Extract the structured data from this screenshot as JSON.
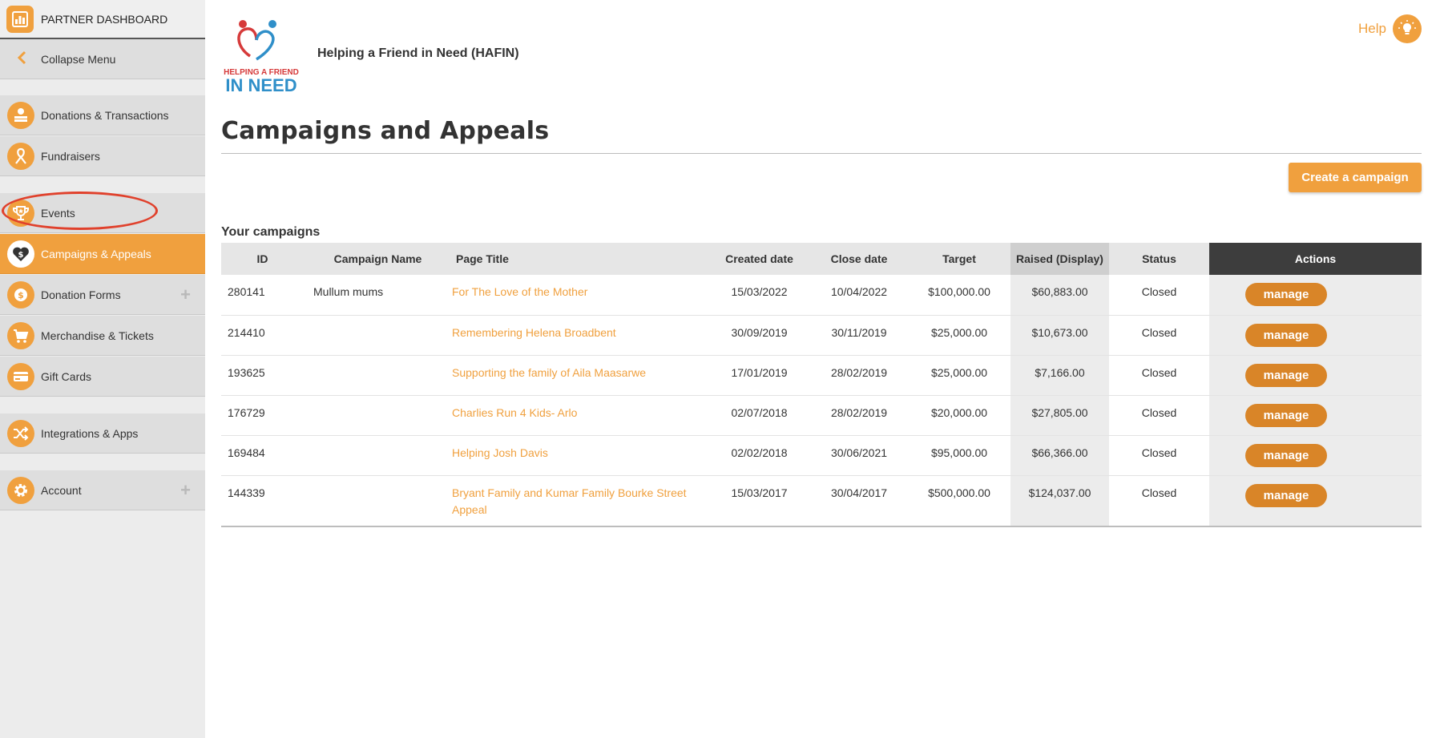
{
  "sidebar": {
    "header_label": "PARTNER DASHBOARD",
    "collapse_label": "Collapse Menu",
    "items": [
      {
        "label": "Donations & Transactions",
        "icon": "donations-icon"
      },
      {
        "label": "Fundraisers",
        "icon": "ribbon-icon"
      },
      {
        "label": "Events",
        "icon": "trophy-icon"
      },
      {
        "label": "Campaigns & Appeals",
        "icon": "heart-dollar-icon",
        "active": true
      },
      {
        "label": "Donation Forms",
        "icon": "coin-icon",
        "expandable": true
      },
      {
        "label": "Merchandise & Tickets",
        "icon": "cart-icon"
      },
      {
        "label": "Gift Cards",
        "icon": "gift-card-icon"
      },
      {
        "label": "Integrations & Apps",
        "icon": "shuffle-icon"
      },
      {
        "label": "Account",
        "icon": "gear-icon",
        "expandable": true
      }
    ],
    "plus_symbol": "+"
  },
  "header": {
    "logo_text_line1": "HELPING A FRIEND",
    "logo_text_line2": "IN NEED",
    "org_name": "Helping a Friend in Need (HAFIN)",
    "help_label": "Help"
  },
  "main": {
    "page_title": "Campaigns and Appeals",
    "create_button_label": "Create a campaign",
    "section_label": "Your campaigns",
    "columns": [
      "ID",
      "Campaign Name",
      "Page Title",
      "Created date",
      "Close date",
      "Target",
      "Raised (Display)",
      "Status",
      "Actions"
    ],
    "rows": [
      {
        "id": "280141",
        "name": "Mullum mums",
        "title": "For The Love of the Mother",
        "created": "15/03/2022",
        "close": "10/04/2022",
        "target": "$100,000.00",
        "raised": "$60,883.00",
        "status": "Closed",
        "action": "manage"
      },
      {
        "id": "214410",
        "name": "",
        "title": "Remembering Helena Broadbent",
        "created": "30/09/2019",
        "close": "30/11/2019",
        "target": "$25,000.00",
        "raised": "$10,673.00",
        "status": "Closed",
        "action": "manage"
      },
      {
        "id": "193625",
        "name": "",
        "title": "Supporting the family of Aila Maasarwe",
        "created": "17/01/2019",
        "close": "28/02/2019",
        "target": "$25,000.00",
        "raised": "$7,166.00",
        "status": "Closed",
        "action": "manage"
      },
      {
        "id": "176729",
        "name": "",
        "title": "Charlies Run 4 Kids- Arlo",
        "created": "02/07/2018",
        "close": "28/02/2019",
        "target": "$20,000.00",
        "raised": "$27,805.00",
        "status": "Closed",
        "action": "manage"
      },
      {
        "id": "169484",
        "name": "",
        "title": "Helping Josh Davis",
        "created": "02/02/2018",
        "close": "30/06/2021",
        "target": "$95,000.00",
        "raised": "$66,366.00",
        "status": "Closed",
        "action": "manage"
      },
      {
        "id": "144339",
        "name": "",
        "title": "Bryant Family and Kumar Family Bourke Street Appeal",
        "created": "15/03/2017",
        "close": "30/04/2017",
        "target": "$500,000.00",
        "raised": "$124,037.00",
        "status": "Closed",
        "action": "manage"
      }
    ]
  },
  "colors": {
    "accent": "#f0a03e",
    "manage_button": "#d98528",
    "highlight": "#e0412c",
    "actions_header": "#3d3d3d"
  }
}
